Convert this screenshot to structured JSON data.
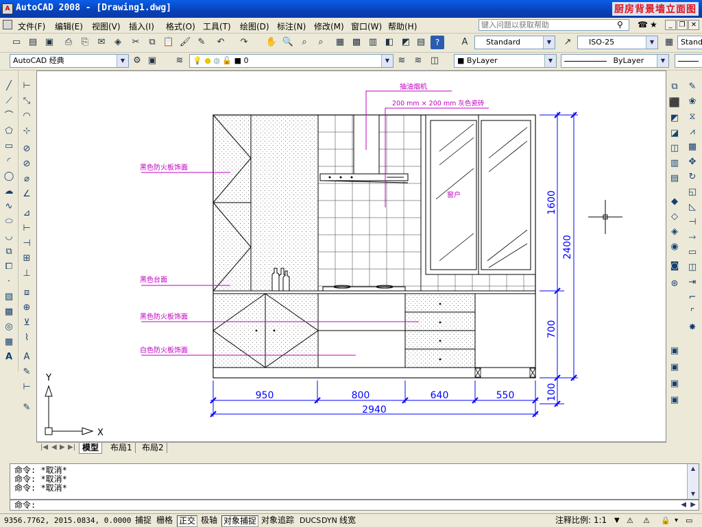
{
  "window": {
    "title": "AutoCAD 2008 - [Drawing1.dwg]",
    "overlay_title": "厨房背景墙立面图"
  },
  "menu": {
    "items": [
      "文件(F)",
      "编辑(E)",
      "视图(V)",
      "插入(I)",
      "格式(O)",
      "工具(T)",
      "绘图(D)",
      "标注(N)",
      "修改(M)",
      "窗口(W)",
      "帮助(H)"
    ],
    "help_placeholder": "键入问题以获取帮助"
  },
  "toolbar": {
    "text_style": "Standard",
    "dim_style": "ISO-25",
    "table_style": "Stand",
    "workspace": "AutoCAD 经典",
    "layer": "0",
    "color": "ByLayer",
    "linetype": "ByLayer"
  },
  "drawing": {
    "labels": {
      "hood": "抽油烟机",
      "tile": "200 mm × 200 mm 灰色瓷砖",
      "upper_panel": "黑色防火板饰面",
      "counter": "黑色台面",
      "lower_panel": "黑色防火板饰面",
      "white_panel": "白色防火板饰面",
      "window": "窗户"
    },
    "dimensions": {
      "seg1": "950",
      "seg2": "800",
      "seg3": "640",
      "seg4": "550",
      "total": "2940",
      "v_upper": "1600",
      "v_total": "2400",
      "v_lower": "700",
      "v_base": "100"
    },
    "ucs": {
      "x": "X",
      "y": "Y"
    }
  },
  "tabs": [
    "模型",
    "布局1",
    "布局2"
  ],
  "command": {
    "history": [
      "命令: *取消*",
      "命令: *取消*",
      "命令: *取消*"
    ],
    "prompt": "命令:"
  },
  "status": {
    "coords": "9356.7762, 2015.0834, 0.0000",
    "toggles": [
      "捕捉",
      "栅格",
      "正交",
      "极轴",
      "对象捕捉",
      "对象追踪",
      "DUCS",
      "DYN",
      "线宽"
    ],
    "scale_label": "注释比例: 1:1"
  },
  "colors": {
    "title_bar": "#0842b8",
    "annotation": "#c000c0",
    "dimension": "#0000ff",
    "canvas": "#ffffff"
  }
}
